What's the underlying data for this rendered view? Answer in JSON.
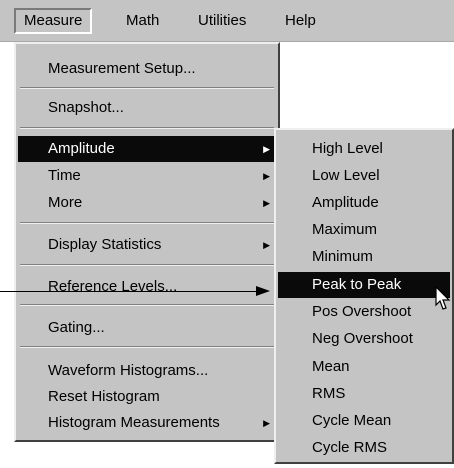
{
  "menubar": {
    "items": [
      {
        "label": "Measure"
      },
      {
        "label": "Math"
      },
      {
        "label": "Utilities"
      },
      {
        "label": "Help"
      }
    ]
  },
  "measure_menu": {
    "items": [
      {
        "label": "Measurement Setup...",
        "submenu": false
      },
      {
        "label": "Snapshot...",
        "submenu": false
      },
      {
        "label": "Amplitude",
        "submenu": true
      },
      {
        "label": "Time",
        "submenu": true
      },
      {
        "label": "More",
        "submenu": true
      },
      {
        "label": "Display Statistics",
        "submenu": true
      },
      {
        "label": "Reference Levels...",
        "submenu": false
      },
      {
        "label": "Gating...",
        "submenu": false
      },
      {
        "label": "Waveform Histograms...",
        "submenu": false
      },
      {
        "label": "Reset Histogram",
        "submenu": false
      },
      {
        "label": "Histogram Measurements",
        "submenu": true
      }
    ],
    "highlighted": "Amplitude"
  },
  "amplitude_submenu": {
    "items": [
      {
        "label": "High Level"
      },
      {
        "label": "Low Level"
      },
      {
        "label": "Amplitude"
      },
      {
        "label": "Maximum"
      },
      {
        "label": "Minimum"
      },
      {
        "label": "Peak to Peak"
      },
      {
        "label": "Pos Overshoot"
      },
      {
        "label": "Neg Overshoot"
      },
      {
        "label": "Mean"
      },
      {
        "label": "RMS"
      },
      {
        "label": "Cycle Mean"
      },
      {
        "label": "Cycle RMS"
      }
    ],
    "highlighted": "Peak to Peak"
  },
  "glyphs": {
    "submenu_arrow": "▶"
  },
  "colors": {
    "menu_bg": "#c4c4c4",
    "highlight_bg": "#0a0a0a",
    "highlight_text": "#ffffff"
  }
}
